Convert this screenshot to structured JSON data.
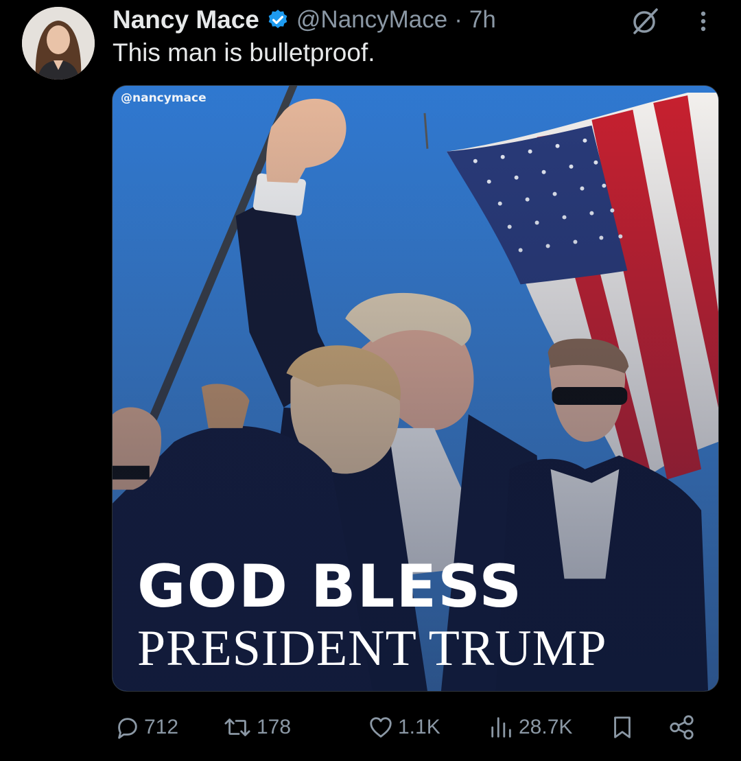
{
  "author": {
    "display_name": "Nancy Mace",
    "handle": "@NancyMace",
    "separator": "·",
    "time": "7h"
  },
  "tweet": {
    "text": "This man is bulletproof."
  },
  "media": {
    "watermark": "@nancymace",
    "headline_line1": "GOD BLESS",
    "headline_line2": "PRESIDENT TRUMP"
  },
  "actions": {
    "replies": "712",
    "reposts": "178",
    "likes": "1.1K",
    "views": "28.7K"
  },
  "colors": {
    "background": "#000000",
    "text_primary": "#e7e9ea",
    "text_secondary": "#8b98a5",
    "verified_blue": "#1d9bf0",
    "media_sky": "#3b82d6",
    "headline_white": "#ffffff"
  },
  "icons": [
    "verified-badge-icon",
    "grok-icon",
    "more-icon",
    "reply-icon",
    "repost-icon",
    "like-icon",
    "views-icon",
    "bookmark-icon",
    "share-icon"
  ]
}
